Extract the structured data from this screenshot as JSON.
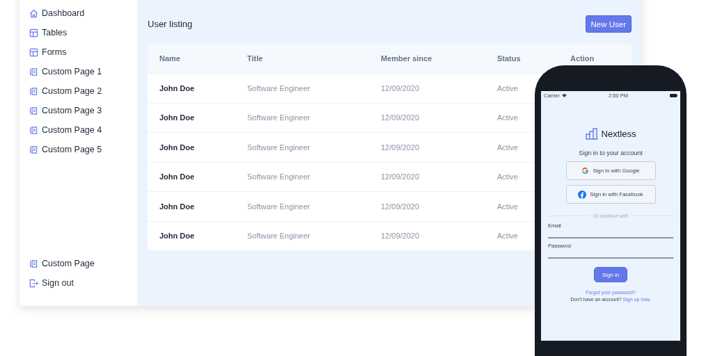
{
  "sidebar": {
    "items": [
      {
        "label": "Dashboard",
        "kind": "home",
        "selected": false
      },
      {
        "label": "Tables",
        "kind": "table",
        "selected": false
      },
      {
        "label": "Forms",
        "kind": "table",
        "selected": false
      },
      {
        "label": "Custom Page 1",
        "kind": "page",
        "selected": false
      },
      {
        "label": "Custom Page 2",
        "kind": "page",
        "selected": false
      },
      {
        "label": "Custom Page 3",
        "kind": "page",
        "selected": false
      },
      {
        "label": "Custom Page 4",
        "kind": "page",
        "selected": false
      },
      {
        "label": "Custom Page 5",
        "kind": "page",
        "selected": false
      }
    ],
    "bottom_items": [
      {
        "label": "Custom Page",
        "kind": "page"
      },
      {
        "label": "Sign out",
        "kind": "logout"
      }
    ]
  },
  "main": {
    "title": "User listing",
    "new_button": "New User",
    "table": {
      "columns": [
        "Name",
        "Title",
        "Member since",
        "Status",
        "Action"
      ],
      "rows": [
        [
          "John Doe",
          "Software Engineer",
          "12/09/2020",
          "Active"
        ],
        [
          "John Doe",
          "Software Engineer",
          "12/09/2020",
          "Active"
        ],
        [
          "John Doe",
          "Software Engineer",
          "12/09/2020",
          "Active"
        ],
        [
          "John Doe",
          "Software Engineer",
          "12/09/2020",
          "Active"
        ],
        [
          "John Doe",
          "Software Engineer",
          "12/09/2020",
          "Active"
        ],
        [
          "John Doe",
          "Software Engineer",
          "12/09/2020",
          "Active"
        ]
      ]
    }
  },
  "phone": {
    "status_bar": {
      "carrier": "Carrier",
      "time": "2:50 PM"
    },
    "brand": "Nextless",
    "heading": "Sign in to your account",
    "providers": [
      {
        "kind": "google",
        "label": "Sign in with Google"
      },
      {
        "kind": "facebook",
        "label": "Sign in with Facebook"
      }
    ],
    "divider": "Or continue with",
    "fields": [
      {
        "label": "Email"
      },
      {
        "label": "Password"
      }
    ],
    "submit": "Sign in",
    "forgot": "Forgot your password?",
    "signup": {
      "text": "Don't have an account?",
      "link": "Sign up now",
      "after": "."
    }
  }
}
